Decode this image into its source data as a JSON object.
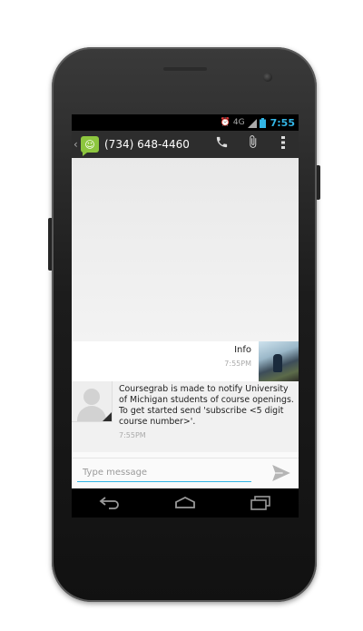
{
  "status_bar": {
    "alarm_icon": "alarm-icon",
    "network_label": "4G",
    "signal_icon": "signal-icon",
    "battery_icon": "battery-icon",
    "time": "7:55"
  },
  "action_bar": {
    "back_glyph": "‹",
    "app_icon": "messaging-icon",
    "app_icon_glyph": "☺",
    "contact": "(734) 648-4460",
    "call_icon": "phone-icon",
    "call_glyph": "✆",
    "attach_icon": "paperclip-icon",
    "attach_glyph": "📎",
    "menu_icon": "overflow-menu-icon",
    "menu_glyph": "⋮"
  },
  "messages": [
    {
      "direction": "sent",
      "text": "Info",
      "time": "7:55PM"
    },
    {
      "direction": "received",
      "text": "Coursegrab is made to notify University of Michigan students of course openings. To get started send 'subscribe <5 digit course number>'.",
      "time": "7:55PM"
    }
  ],
  "compose": {
    "placeholder": "Type message",
    "value": "",
    "send_icon": "send-icon"
  },
  "nav_bar": {
    "back_icon": "back-arrow-icon",
    "home_icon": "home-icon",
    "recents_icon": "recent-apps-icon"
  },
  "colors": {
    "accent": "#33b5e5",
    "action_bar": "#2d2d2d",
    "app_icon": "#8dc63f"
  }
}
